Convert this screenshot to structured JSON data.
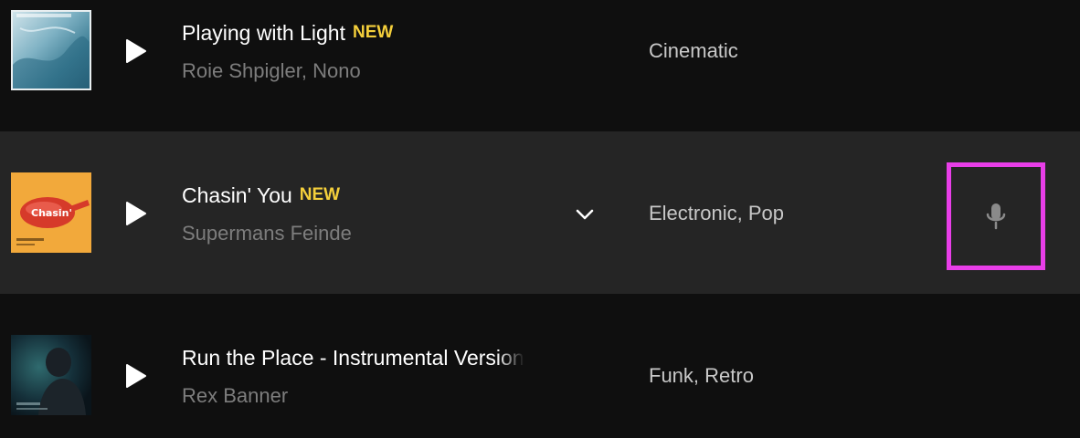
{
  "tracks": [
    {
      "title": "Playing with Light",
      "badge": "NEW",
      "artist": "Roie Shpigler, Nono",
      "genres": "Cinematic",
      "cover_text": "PLAYING WITH LIGHT"
    },
    {
      "title": "Chasin' You",
      "badge": "NEW",
      "artist": "Supermans Feinde",
      "genres": "Electronic, Pop",
      "cover_text": "Chasin' You"
    },
    {
      "title": "Run the Place - Instrumental Version",
      "artist": "Rex Banner",
      "genres": "Funk, Retro"
    }
  ],
  "icons": {
    "play": "play-icon",
    "expand": "chevron-down-icon",
    "vocals": "microphone-icon"
  },
  "colors": {
    "background": "#0f0f0f",
    "row_hover": "#252525",
    "badge": "#f4cf3b",
    "highlight": "#e83ee8"
  }
}
